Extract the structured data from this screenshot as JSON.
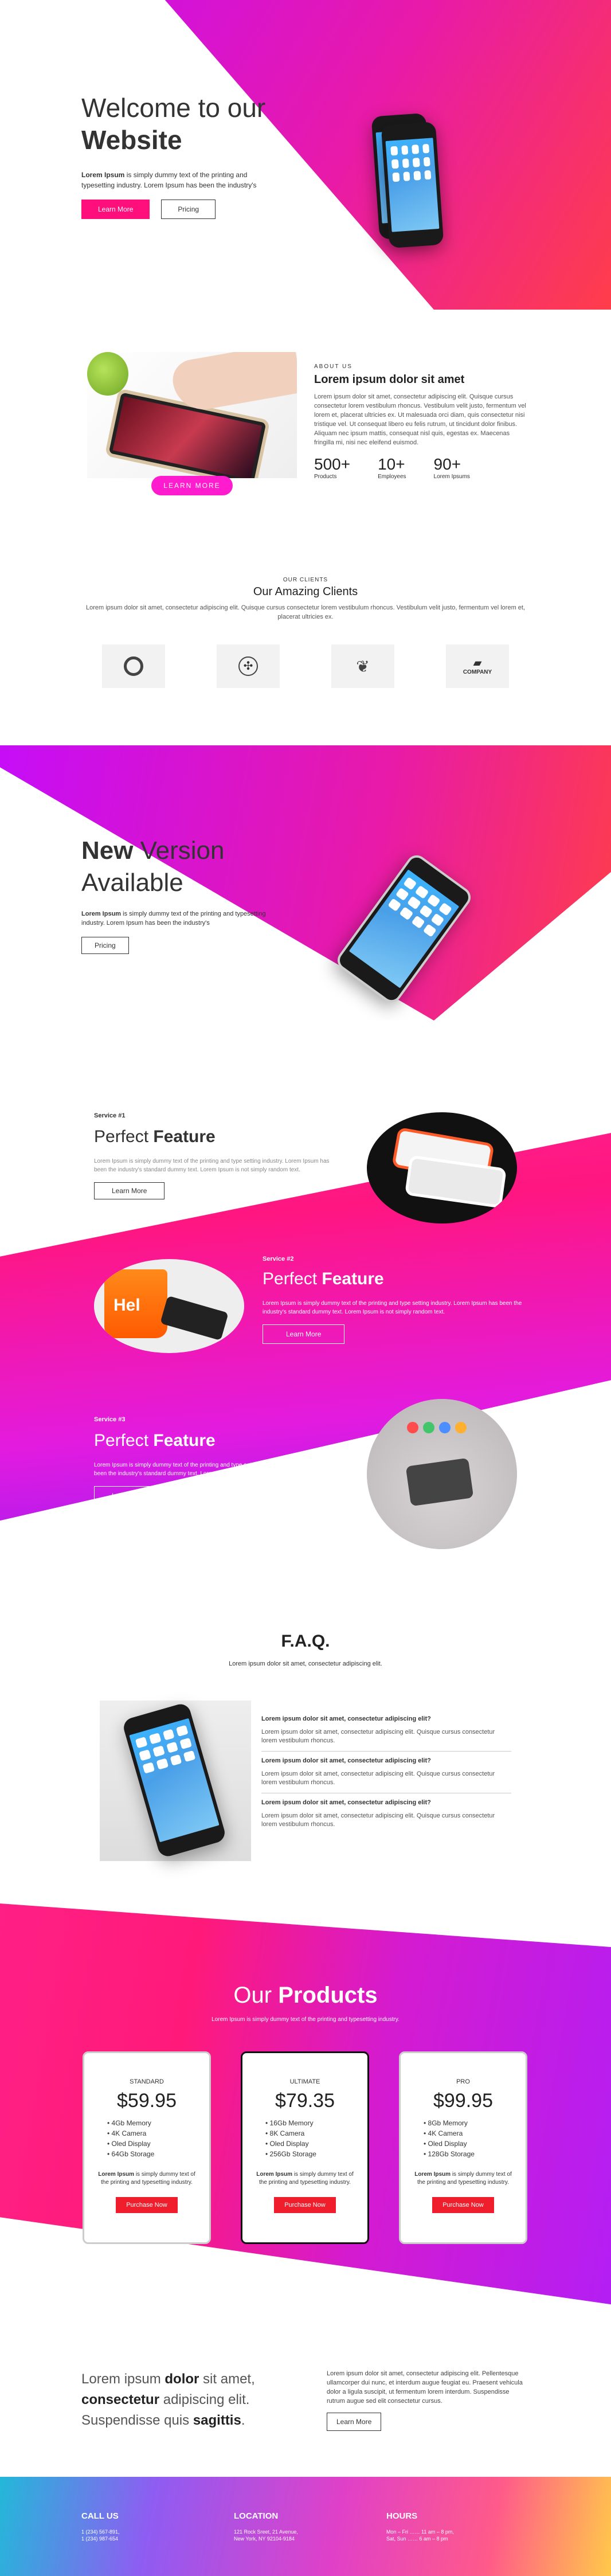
{
  "hero": {
    "title_light": "Welcome to our",
    "title_bold": "Website",
    "text_bold": "Lorem Ipsum",
    "text": " is simply dummy text of the printing and typesetting industry. Lorem Ipsum has been the industry's",
    "btn1": "Learn More",
    "btn2": "Pricing"
  },
  "about": {
    "eyebrow": "ABOUT US",
    "title": "Lorem ipsum dolor sit amet",
    "text": "Lorem ipsum dolor sit amet, consectetur adipiscing elit. Quisque cursus consectetur lorem vestibulum rhoncus. Vestibulum velit justo, fermentum vel lorem et, placerat ultricies ex. Ut malesuada orci diam, quis consectetur nisi tristique vel. Ut consequat libero eu felis rutrum, ut tincidunt dolor finibus. Aliquam nec ipsum mattis, consequat nisl quis, egestas ex. Maecenas fringilla mi, nisi nec eleifend euismod.",
    "badge": "LEARN MORE",
    "stats": [
      {
        "num": "500+",
        "label": "Products"
      },
      {
        "num": "10+",
        "label": "Employees"
      },
      {
        "num": "90+",
        "label": "Lorem Ipsums"
      }
    ]
  },
  "clients": {
    "eyebrow": "OUR CLIENTS",
    "title": "Our Amazing Clients",
    "text": "Lorem ipsum dolor sit amet, consectetur adipiscing elit. Quisque cursus consectetur lorem vestibulum rhoncus. Vestibulum velit justo, fermentum vel lorem et, placerat ultricies ex.",
    "logo4": "COMPANY"
  },
  "version": {
    "title_bold": "New",
    "title_light": " Version",
    "title_line2": "Available",
    "text_bold": "Lorem Ipsum",
    "text": " is simply dummy text of the printing and typesetting industry. Lorem Ipsum has been the industry's",
    "btn": "Pricing"
  },
  "features": [
    {
      "tag": "Service #1",
      "light": "Perfect ",
      "bold": "Feature",
      "text": "Lorem Ipsum is simply dummy text of the printing and type setting industry. Lorem Ipsum has been the industry's standard dummy text. Lorem Ipsum is not simply random text.",
      "btn": "Learn More"
    },
    {
      "tag": "Service #2",
      "light": "Perfect ",
      "bold": "Feature",
      "text": "Lorem Ipsum is simply dummy text of the printing and type setting industry. Lorem Ipsum has been the industry's standard dummy text. Lorem Ipsum is not simply random text.",
      "btn": "Learn More",
      "mug": "Hel"
    },
    {
      "tag": "Service #3",
      "light": "Perfect ",
      "bold": "Feature",
      "text": "Lorem Ipsum is simply dummy text of the printing and type setting industry. Lorem Ipsum has been the industry's standard dummy text. Lorem Ipsum is not simply random text.",
      "btn": "Learn More"
    }
  ],
  "faq": {
    "title": "F.A.Q.",
    "subtitle": "Lorem ipsum dolor sit amet, consectetur adipiscing elit.",
    "items": [
      {
        "q": "Lorem ipsum dolor sit amet, consectetur adipiscing elit?",
        "a": "Lorem ipsum dolor sit amet, consectetur adipiscing elit. Quisque cursus consectetur lorem vestibulum rhoncus."
      },
      {
        "q": "Lorem ipsum dolor sit amet, consectetur adipiscing elit?",
        "a": "Lorem ipsum dolor sit amet, consectetur adipiscing elit. Quisque cursus consectetur lorem vestibulum rhoncus."
      },
      {
        "q": "Lorem ipsum dolor sit amet, consectetur adipiscing elit?",
        "a": "Lorem ipsum dolor sit amet, consectetur adipiscing elit. Quisque cursus consectetur lorem vestibulum rhoncus."
      }
    ]
  },
  "products": {
    "title_light": "Our ",
    "title_bold": "Products",
    "subtitle": "Lorem Ipsum is simply dummy text of the printing and typesetting industry.",
    "plans": [
      {
        "name": "STANDARD",
        "price": "$59.95",
        "features": [
          "4Gb Memory",
          "4K Camera",
          "Oled Display",
          "64Gb Storage"
        ],
        "desc_bold": "Lorem Ipsum",
        "desc": " is simply dummy text of the printing and typesetting industry.",
        "btn": "Purchase Now"
      },
      {
        "name": "ULTIMATE",
        "price": "$79.35",
        "features": [
          "16Gb Memory",
          "8K Camera",
          "Oled Display",
          "256Gb Storage"
        ],
        "desc_bold": "Lorem Ipsum",
        "desc": " is simply dummy text of the printing and typesetting industry.",
        "btn": "Purchase Now"
      },
      {
        "name": "PRO",
        "price": "$99.95",
        "features": [
          "8Gb Memory",
          "4K Camera",
          "Oled Display",
          "128Gb Storage"
        ],
        "desc_bold": "Lorem Ipsum",
        "desc": " is simply dummy text of the printing and typesetting industry.",
        "btn": "Purchase Now"
      }
    ]
  },
  "cta": {
    "l1a": "Lorem ipsum ",
    "l1b": "dolor",
    "l1c": " sit amet,",
    "l2a": "consectetur",
    "l2b": " adipiscing elit.",
    "l3a": "Suspendisse quis ",
    "l3b": "sagittis",
    "l3c": ".",
    "text": "Lorem ipsum dolor sit amet, consectetur adipiscing elit. Pellentesque ullamcorper dui nunc, et interdum augue feugiat eu. Praesent vehicula dolor a ligula suscipit, ut fermentum lorem interdum. Suspendisse rutrum augue sed elit consectetur cursus.",
    "btn": "Learn More"
  },
  "footer": {
    "call": {
      "title": "CALL US",
      "l1": "1 (234) 567-891,",
      "l2": "1 (234) 987-654"
    },
    "location": {
      "title": "LOCATION",
      "l1": "121 Rock Sreet, 21 Avenue,",
      "l2": "New York, NY 92104-9184"
    },
    "hours": {
      "title": "HOURS",
      "l1": "Mon – Fri …… 11 am – 8 pm,",
      "l2": "Sat, Sun …… 6 am – 8 pm"
    }
  }
}
